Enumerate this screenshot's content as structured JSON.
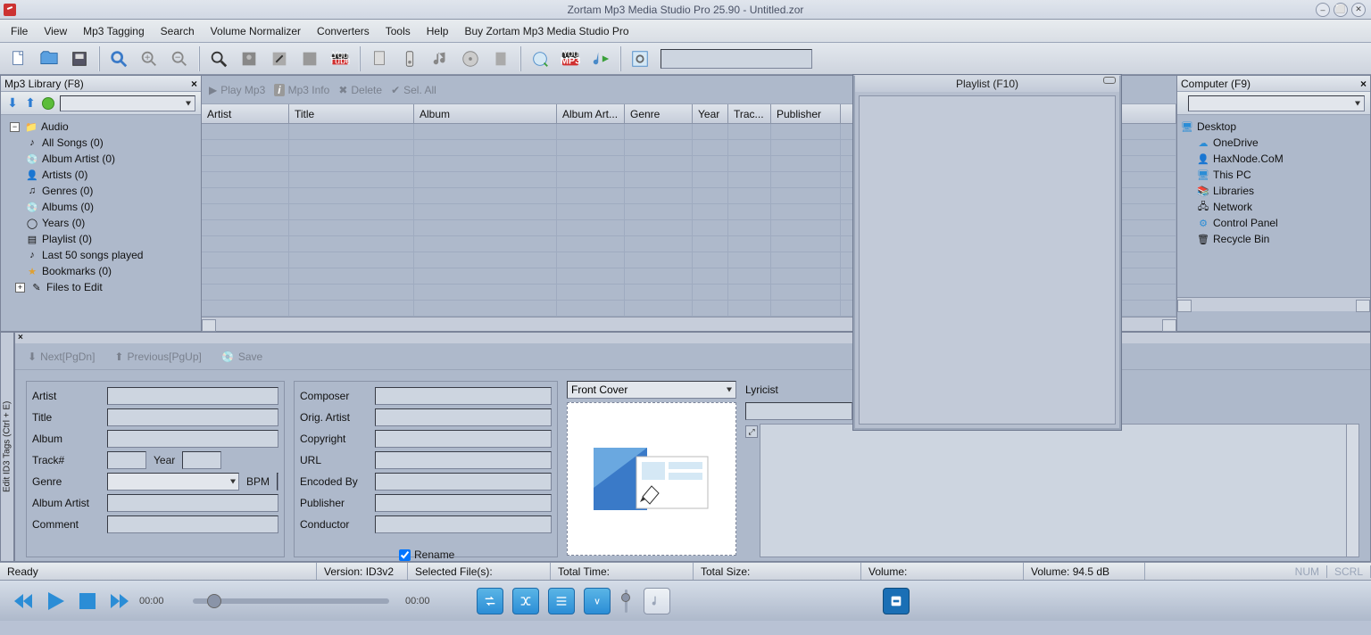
{
  "window": {
    "title": "Zortam Mp3 Media Studio Pro 25.90 - Untitled.zor"
  },
  "menu": {
    "file": "File",
    "view": "View",
    "mp3tagging": "Mp3 Tagging",
    "search": "Search",
    "volnorm": "Volume Normalizer",
    "converters": "Converters",
    "tools": "Tools",
    "help": "Help",
    "buy": "Buy Zortam Mp3 Media Studio Pro"
  },
  "library": {
    "header": "Mp3 Library (F8)",
    "root": "Audio",
    "items": [
      {
        "label": "All Songs (0)"
      },
      {
        "label": "Album Artist (0)"
      },
      {
        "label": "Artists (0)"
      },
      {
        "label": "Genres (0)"
      },
      {
        "label": "Albums (0)"
      },
      {
        "label": "Years (0)"
      },
      {
        "label": "Playlist (0)"
      },
      {
        "label": "Last 50 songs played"
      },
      {
        "label": "Bookmarks (0)"
      },
      {
        "label": "Files to Edit"
      }
    ]
  },
  "center": {
    "play": "Play Mp3",
    "info": "Mp3 Info",
    "delete": "Delete",
    "selall": "Sel. All",
    "cols": {
      "artist": "Artist",
      "title": "Title",
      "album": "Album",
      "albumart": "Album Art...",
      "genre": "Genre",
      "year": "Year",
      "track": "Trac...",
      "publisher": "Publisher"
    }
  },
  "computer": {
    "header": "Computer (F9)",
    "root": "Desktop",
    "items": [
      {
        "label": "OneDrive"
      },
      {
        "label": "HaxNode.CoM"
      },
      {
        "label": "This PC"
      },
      {
        "label": "Libraries"
      },
      {
        "label": "Network"
      },
      {
        "label": "Control Panel"
      },
      {
        "label": "Recycle Bin"
      }
    ]
  },
  "playlist": {
    "title": "Playlist (F10)"
  },
  "editor": {
    "tab": "Edit ID3 Tags (Ctrl + E)",
    "next": "Next[PgDn]",
    "prev": "Previous[PgUp]",
    "save": "Save",
    "left": {
      "artist": "Artist",
      "title": "Title",
      "album": "Album",
      "track": "Track#",
      "year": "Year",
      "genre": "Genre",
      "bpm": "BPM",
      "albumartist": "Album Artist",
      "comment": "Comment"
    },
    "mid": {
      "composer": "Composer",
      "origartist": "Orig. Artist",
      "copyright": "Copyright",
      "url": "URL",
      "encodedby": "Encoded By",
      "publisher": "Publisher",
      "conductor": "Conductor"
    },
    "cover": "Front Cover",
    "lyricist": "Lyricist",
    "rename": "Rename"
  },
  "status": {
    "ready": "Ready",
    "version": "Version: ID3v2",
    "selfiles": "Selected File(s):",
    "totaltime": "Total Time:",
    "totalsize": "Total Size:",
    "volume": "Volume:",
    "voldb": "Volume: 94.5 dB",
    "num": "NUM",
    "scrl": "SCRL"
  },
  "player": {
    "time0": "00:00",
    "time1": "00:00"
  }
}
